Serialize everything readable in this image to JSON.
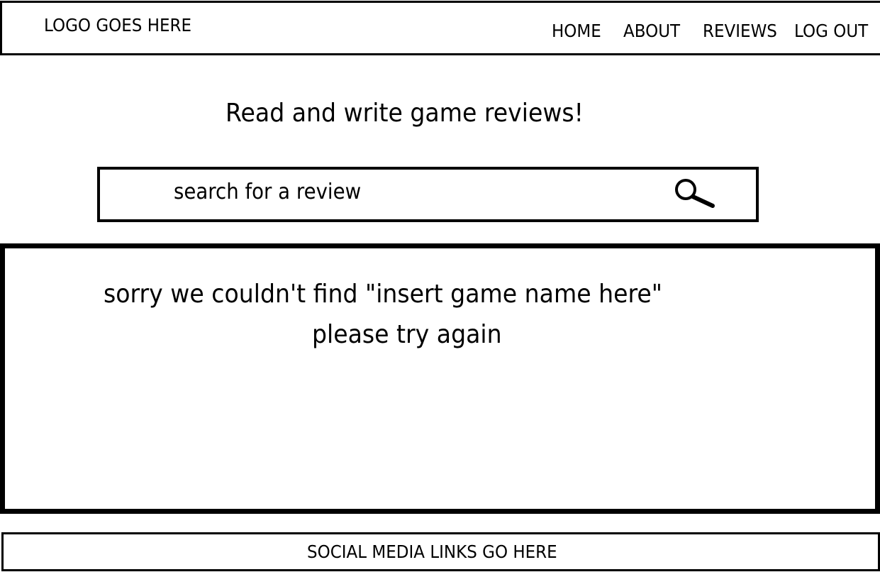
{
  "header": {
    "logo_text": "LOGO GOES HERE",
    "nav": {
      "home": "HOME",
      "about": "ABOUT",
      "reviews": "REVIEWS",
      "logout": "LOG OUT"
    }
  },
  "main": {
    "tagline": "Read and write game reviews!",
    "search": {
      "placeholder": "search for a review",
      "icon": "search-icon"
    },
    "results": {
      "message_line1": "sorry we couldn't find \"insert game name here\"",
      "message_line2": "please try again"
    }
  },
  "footer": {
    "social_text": "SOCIAL MEDIA LINKS GO HERE"
  },
  "colors": {
    "foreground": "#000000",
    "background": "#ffffff"
  }
}
